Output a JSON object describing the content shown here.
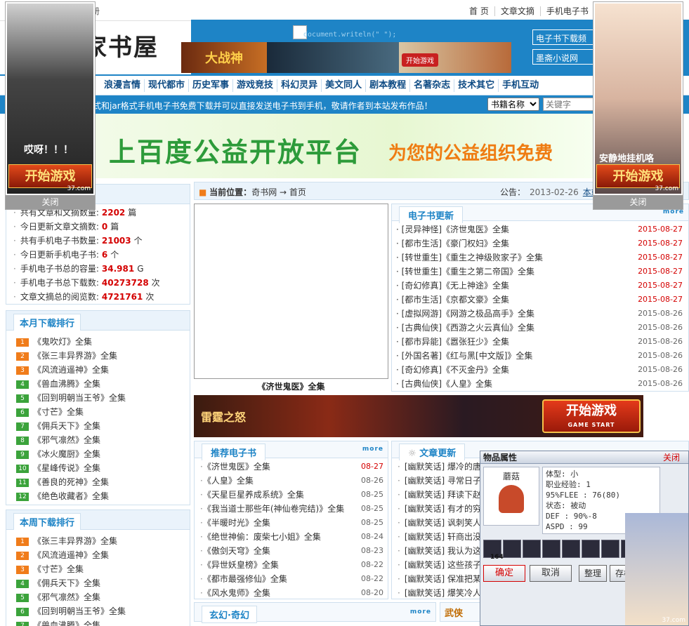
{
  "topbar": {
    "register": "注册",
    "links": [
      "首 页",
      "文章文摘",
      "手机电子书"
    ]
  },
  "header": {
    "logo": "家书屋",
    "doc_write": "document.writeln(\" \");",
    "ad_title": "大战神",
    "ad_start": "开始游戏",
    "right_btn_1": "电子书下载频",
    "right_btn_2": "墨斋小说网"
  },
  "nav": {
    "items": [
      "浪漫言情",
      "现代都市",
      "历史军事",
      "游戏竞技",
      "科幻灵异",
      "美文同人",
      "剧本教程",
      "名著杂志",
      "技术其它",
      "手机互动"
    ]
  },
  "notice": {
    "message": "式和jar格式手机电子书免费下载并可以直接发送电子书到手机，敬请作者到本站发布作品！",
    "select_value": "书籍名称",
    "search_placeholder": "关键字"
  },
  "banner": {
    "main": "上百度公益开放平台",
    "sub": "为您的公益组织免费"
  },
  "stats": {
    "rows": [
      {
        "label": "共有文章和文摘数量:",
        "value": "2202",
        "unit": "篇"
      },
      {
        "label": "今日更新文章文摘数:",
        "value": "0",
        "unit": "篇"
      },
      {
        "label": "共有手机电子书数量:",
        "value": "21003",
        "unit": "个"
      },
      {
        "label": "今日更新手机电子书:",
        "value": "6",
        "unit": "个"
      },
      {
        "label": "手机电子书总的容量:",
        "value": "34.981",
        "unit": "G"
      },
      {
        "label": "手机电子书总下载数:",
        "value": "40273728",
        "unit": "次"
      },
      {
        "label": "文章文摘总的阅览数:",
        "value": "4721761",
        "unit": "次"
      }
    ]
  },
  "monthly": {
    "title": "本月下载排行",
    "items": [
      "《鬼吹灯》全集",
      "《张三丰异界游》全集",
      "《风流逍遥神》全集",
      "《兽血沸腾》全集",
      "《回到明朝当王爷》全集",
      "《寸芒》全集",
      "《佣兵天下》全集",
      "《邪气凛然》全集",
      "《冰火魔厨》全集",
      "《星峰传说》全集",
      "《善良的死神》全集",
      "《绝色收藏者》全集"
    ]
  },
  "weekly": {
    "title": "本周下载排行",
    "items": [
      "《张三丰异界游》全集",
      "《风流逍遥神》全集",
      "《寸芒》全集",
      "《佣兵天下》全集",
      "《邪气凛然》全集",
      "《回到明朝当王爷》全集",
      "《兽血沸腾》全集"
    ]
  },
  "breadcrumb": {
    "label": "当前位置：",
    "site": "奇书网",
    "arrow": "→",
    "page": "首页",
    "notice_label": "公告：",
    "notice_date": "2013-02-26",
    "notice_link": "本站新"
  },
  "cover": {
    "caption": "《济世鬼医》全集"
  },
  "ebook_updates": {
    "title": "电子书更新",
    "more": "more",
    "rows": [
      {
        "cat": "[灵异神怪]",
        "name": "《济世鬼医》全集",
        "date": "2015-08-27",
        "red": true
      },
      {
        "cat": "[都市生活]",
        "name": "《豪门权妇》全集",
        "date": "2015-08-27",
        "red": true
      },
      {
        "cat": "[转世重生]",
        "name": "《重生之神级败家子》全集",
        "date": "2015-08-27",
        "red": true
      },
      {
        "cat": "[转世重生]",
        "name": "《重生之第二帝国》全集",
        "date": "2015-08-27",
        "red": true
      },
      {
        "cat": "[奇幻修真]",
        "name": "《无上神途》全集",
        "date": "2015-08-27",
        "red": true
      },
      {
        "cat": "[都市生活]",
        "name": "《京都文豪》全集",
        "date": "2015-08-27",
        "red": true
      },
      {
        "cat": "[虚拟网游]",
        "name": "《网游之极品高手》全集",
        "date": "2015-08-26",
        "red": false
      },
      {
        "cat": "[古典仙侠]",
        "name": "《西游之火云真仙》全集",
        "date": "2015-08-26",
        "red": false
      },
      {
        "cat": "[都市异能]",
        "name": "《嚣张狂少》全集",
        "date": "2015-08-26",
        "red": false
      },
      {
        "cat": "[外国名著]",
        "name": "《红与黑[中文版]》全集",
        "date": "2015-08-26",
        "red": false
      },
      {
        "cat": "[奇幻修真]",
        "name": "《不灭金丹》全集",
        "date": "2015-08-26",
        "red": false
      },
      {
        "cat": "[古典仙侠]",
        "name": "《人皇》全集",
        "date": "2015-08-26",
        "red": false
      }
    ]
  },
  "mid_banner": {
    "title": "雷霆之怒",
    "start": "开始游戏",
    "start_en": "GAME START"
  },
  "recommend": {
    "title": "推荐电子书",
    "more": "more",
    "rows": [
      {
        "name": "《济世鬼医》全集",
        "date": "08-27",
        "red": true
      },
      {
        "name": "《人皇》全集",
        "date": "08-26",
        "red": false
      },
      {
        "name": "《天星巨星养成系统》全集",
        "date": "08-25",
        "red": false
      },
      {
        "name": "《我当道士那些年(神仙卷完结)》全集",
        "date": "08-25",
        "red": false
      },
      {
        "name": "《半暖时光》全集",
        "date": "08-25",
        "red": false
      },
      {
        "name": "《绝世神偷：废柴七小姐》全集",
        "date": "08-24",
        "red": false
      },
      {
        "name": "《傲剑天穹》全集",
        "date": "08-23",
        "red": false
      },
      {
        "name": "《异世妖皇榜》全集",
        "date": "08-22",
        "red": false
      },
      {
        "name": "《都市最强修仙》全集",
        "date": "08-22",
        "red": false
      },
      {
        "name": "《风水鬼师》全集",
        "date": "08-20",
        "red": false
      }
    ]
  },
  "articles": {
    "title": "文章更新",
    "rows": [
      "[幽默笑话] 爆冷的唐",
      "[幽默笑话] 寻常日子",
      "[幽默笑话] 拜读下赵",
      "[幽默笑话] 有才的穷",
      "[幽默笑话] 讽刺笑人",
      "[幽默笑话] 轩商出没",
      "[幽默笑话] 我认为这",
      "[幽默笑话] 这些孩子",
      "[幽默笑话] 保准把某",
      "[幽默笑话] 爆笑冷人"
    ]
  },
  "bottom_sections": {
    "xuanhuan": "玄幻·奇幻",
    "more": "more",
    "wuxia": "武侠"
  },
  "float_left": {
    "bubble": "哎呀！！！",
    "start": "开始游戏",
    "wm": "37.com",
    "close": "关闭"
  },
  "float_right": {
    "bubble": "安静地挂机咯",
    "start": "开始游戏",
    "wm": "37.com",
    "close": "关闭"
  },
  "game_win": {
    "title": "物品属性",
    "close": "关闭",
    "item_name": "蘑菇",
    "stats": [
      "体型: 小",
      "职业经验: 1",
      "95%FLEE : 76(80)",
      "状态: 被动",
      "DEF : 90%-8",
      "ASPD : 99"
    ],
    "count": "164",
    "ok": "确定",
    "cancel": "取消",
    "sort": "整理",
    "store": "存档",
    "wm": "37.com"
  },
  "colors": {
    "brand_blue": "#1e84c6",
    "red": "#d40000",
    "orange": "#f07c1a",
    "green": "#3ba33b"
  }
}
